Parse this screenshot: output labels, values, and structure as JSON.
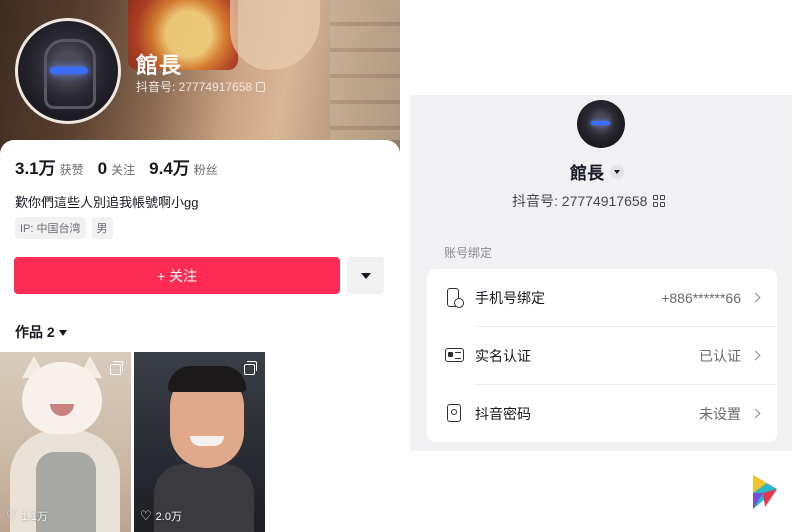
{
  "profile": {
    "name": "館長",
    "douyin_id": "抖音号: 27774917658",
    "stats": [
      {
        "value": "3.1万",
        "label": "获赞"
      },
      {
        "value": "0",
        "label": "关注"
      },
      {
        "value": "9.4万",
        "label": "粉丝"
      }
    ],
    "bio": "歎你們這些人別追我帳號啊小gg",
    "tags": [
      "IP: 中国台湾",
      "男"
    ],
    "follow_label": "+ 关注",
    "works_tab": "作品 2",
    "works": [
      {
        "likes": "1.1万"
      },
      {
        "likes": "2.0万"
      }
    ]
  },
  "settings": {
    "name": "館長",
    "douyin_id": "抖音号: 27774917658",
    "section_label": "账号绑定",
    "rows": [
      {
        "label": "手机号绑定",
        "value": "+886******66",
        "icon": "phone-icon"
      },
      {
        "label": "实名认证",
        "value": "已认证",
        "icon": "id-card-icon"
      },
      {
        "label": "抖音密码",
        "value": "未设置",
        "icon": "lock-icon"
      }
    ]
  },
  "colors": {
    "follow_button": "#fe2c55",
    "settings_background": "#f1f1f4"
  }
}
